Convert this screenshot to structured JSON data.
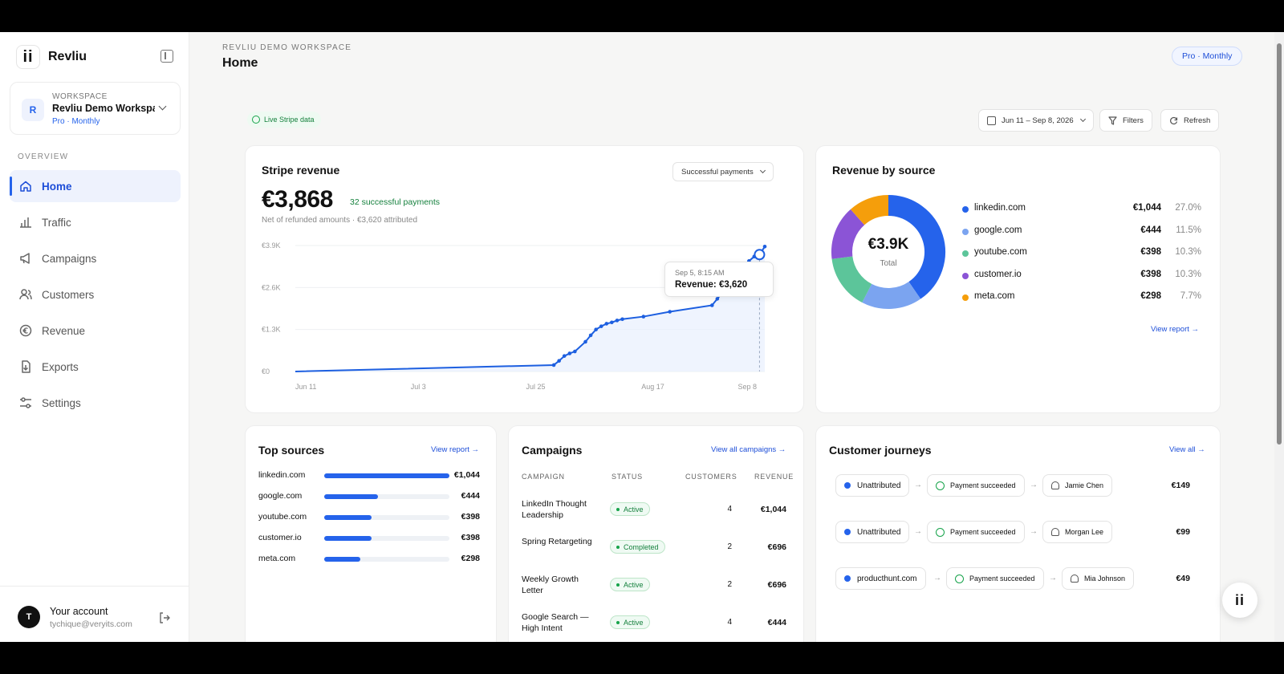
{
  "brand": {
    "name": "Revliu",
    "logo_text": "ii"
  },
  "workspace": {
    "label": "WORKSPACE",
    "initial": "R",
    "name": "Revliu Demo Workspace",
    "plan": "Pro · Monthly"
  },
  "nav": {
    "section": "OVERVIEW",
    "items": [
      {
        "label": "Home",
        "icon": "home-icon"
      },
      {
        "label": "Traffic",
        "icon": "bar-chart-icon"
      },
      {
        "label": "Campaigns",
        "icon": "megaphone-icon"
      },
      {
        "label": "Customers",
        "icon": "users-icon"
      },
      {
        "label": "Revenue",
        "icon": "currency-icon"
      },
      {
        "label": "Exports",
        "icon": "export-icon"
      },
      {
        "label": "Settings",
        "icon": "sliders-icon"
      }
    ]
  },
  "account": {
    "initial": "T",
    "name": "Your account",
    "email": "tychique@veryits.com"
  },
  "header": {
    "crumb": "REVLIU DEMO WORKSPACE",
    "title": "Home",
    "plan_pill": "Pro · Monthly"
  },
  "toolbar": {
    "live_badge": "Live Stripe data",
    "date_range": "Jun 11 – Sep 8, 2026",
    "filters": "Filters",
    "refresh": "Refresh"
  },
  "stripe_revenue": {
    "title": "Stripe revenue",
    "select": "Successful payments",
    "total": "€3,868",
    "payments": "32 successful payments",
    "note": "Net of refunded amounts · €3,620 attributed",
    "tooltip": {
      "date": "Sep 5, 8:15 AM",
      "value": "Revenue: €3,620"
    }
  },
  "chart_data": [
    {
      "type": "line",
      "yticks": [
        "€3.9K",
        "€2.6K",
        "€1.3K",
        "€0"
      ],
      "xticks": [
        "Jun 11",
        "Jul 3",
        "Jul 25",
        "Aug 17",
        "Sep 8"
      ],
      "ylim": [
        0,
        3900
      ],
      "x_domain": [
        0,
        89
      ],
      "series": [
        {
          "x": [
            0,
            49,
            50,
            51,
            52,
            53,
            55,
            56,
            57,
            58,
            59,
            60,
            61,
            62,
            66,
            71,
            79,
            80,
            81,
            82,
            83,
            84,
            85,
            86,
            87,
            88,
            89
          ],
          "y": [
            0,
            200,
            330,
            480,
            560,
            620,
            920,
            1120,
            1300,
            1400,
            1480,
            1520,
            1580,
            1620,
            1700,
            1850,
            2050,
            2250,
            2450,
            2650,
            2850,
            3050,
            3250,
            3420,
            3560,
            3620,
            3868
          ]
        }
      ]
    },
    {
      "type": "pie",
      "center_value": "€3.9K",
      "center_label": "Total",
      "categories": [
        "linkedin.com",
        "google.com",
        "youtube.com",
        "customer.io",
        "meta.com"
      ],
      "values": [
        1044,
        444,
        398,
        398,
        298
      ],
      "colors": [
        "#2563eb",
        "#7ba4f0",
        "#5cc59a",
        "#8b54d6",
        "#f59e0b"
      ]
    }
  ],
  "revenue_by_source": {
    "title": "Revenue by source",
    "rows": [
      {
        "name": "linkedin.com",
        "value": "€1,044",
        "pct": "27.0%",
        "color": "#2563eb"
      },
      {
        "name": "google.com",
        "value": "€444",
        "pct": "11.5%",
        "color": "#7ba4f0"
      },
      {
        "name": "youtube.com",
        "value": "€398",
        "pct": "10.3%",
        "color": "#5cc59a"
      },
      {
        "name": "customer.io",
        "value": "€398",
        "pct": "10.3%",
        "color": "#8b54d6"
      },
      {
        "name": "meta.com",
        "value": "€298",
        "pct": "7.7%",
        "color": "#f59e0b"
      }
    ],
    "link": "View report →"
  },
  "top_sources": {
    "title": "Top sources",
    "link": "View report →",
    "rows": [
      {
        "name": "linkedin.com",
        "value": "€1,044",
        "fill": 1.0
      },
      {
        "name": "google.com",
        "value": "€444",
        "fill": 0.43
      },
      {
        "name": "youtube.com",
        "value": "€398",
        "fill": 0.38
      },
      {
        "name": "customer.io",
        "value": "€398",
        "fill": 0.38
      },
      {
        "name": "meta.com",
        "value": "€298",
        "fill": 0.29
      }
    ]
  },
  "campaigns": {
    "title": "Campaigns",
    "link": "View all campaigns →",
    "columns": [
      "CAMPAIGN",
      "STATUS",
      "CUSTOMERS",
      "REVENUE"
    ],
    "rows": [
      {
        "name": "LinkedIn Thought Leadership",
        "status": "Active",
        "customers": "4",
        "revenue": "€1,044"
      },
      {
        "name": "Spring Retargeting",
        "status": "Completed",
        "customers": "2",
        "revenue": "€696"
      },
      {
        "name": "Weekly Growth Letter",
        "status": "Active",
        "customers": "2",
        "revenue": "€696"
      },
      {
        "name": "Google Search — High Intent",
        "status": "Active",
        "customers": "4",
        "revenue": "€444"
      }
    ]
  },
  "journeys": {
    "title": "Customer journeys",
    "link": "View all →",
    "rows": [
      {
        "source": "Unattributed",
        "event": "Payment succeeded",
        "customer": "Jamie Chen",
        "amount": "€149"
      },
      {
        "source": "Unattributed",
        "event": "Payment succeeded",
        "customer": "Morgan Lee",
        "amount": "€99"
      },
      {
        "source": "producthunt.com",
        "event": "Payment succeeded",
        "customer": "Mia Johnson",
        "amount": "€49"
      }
    ]
  }
}
